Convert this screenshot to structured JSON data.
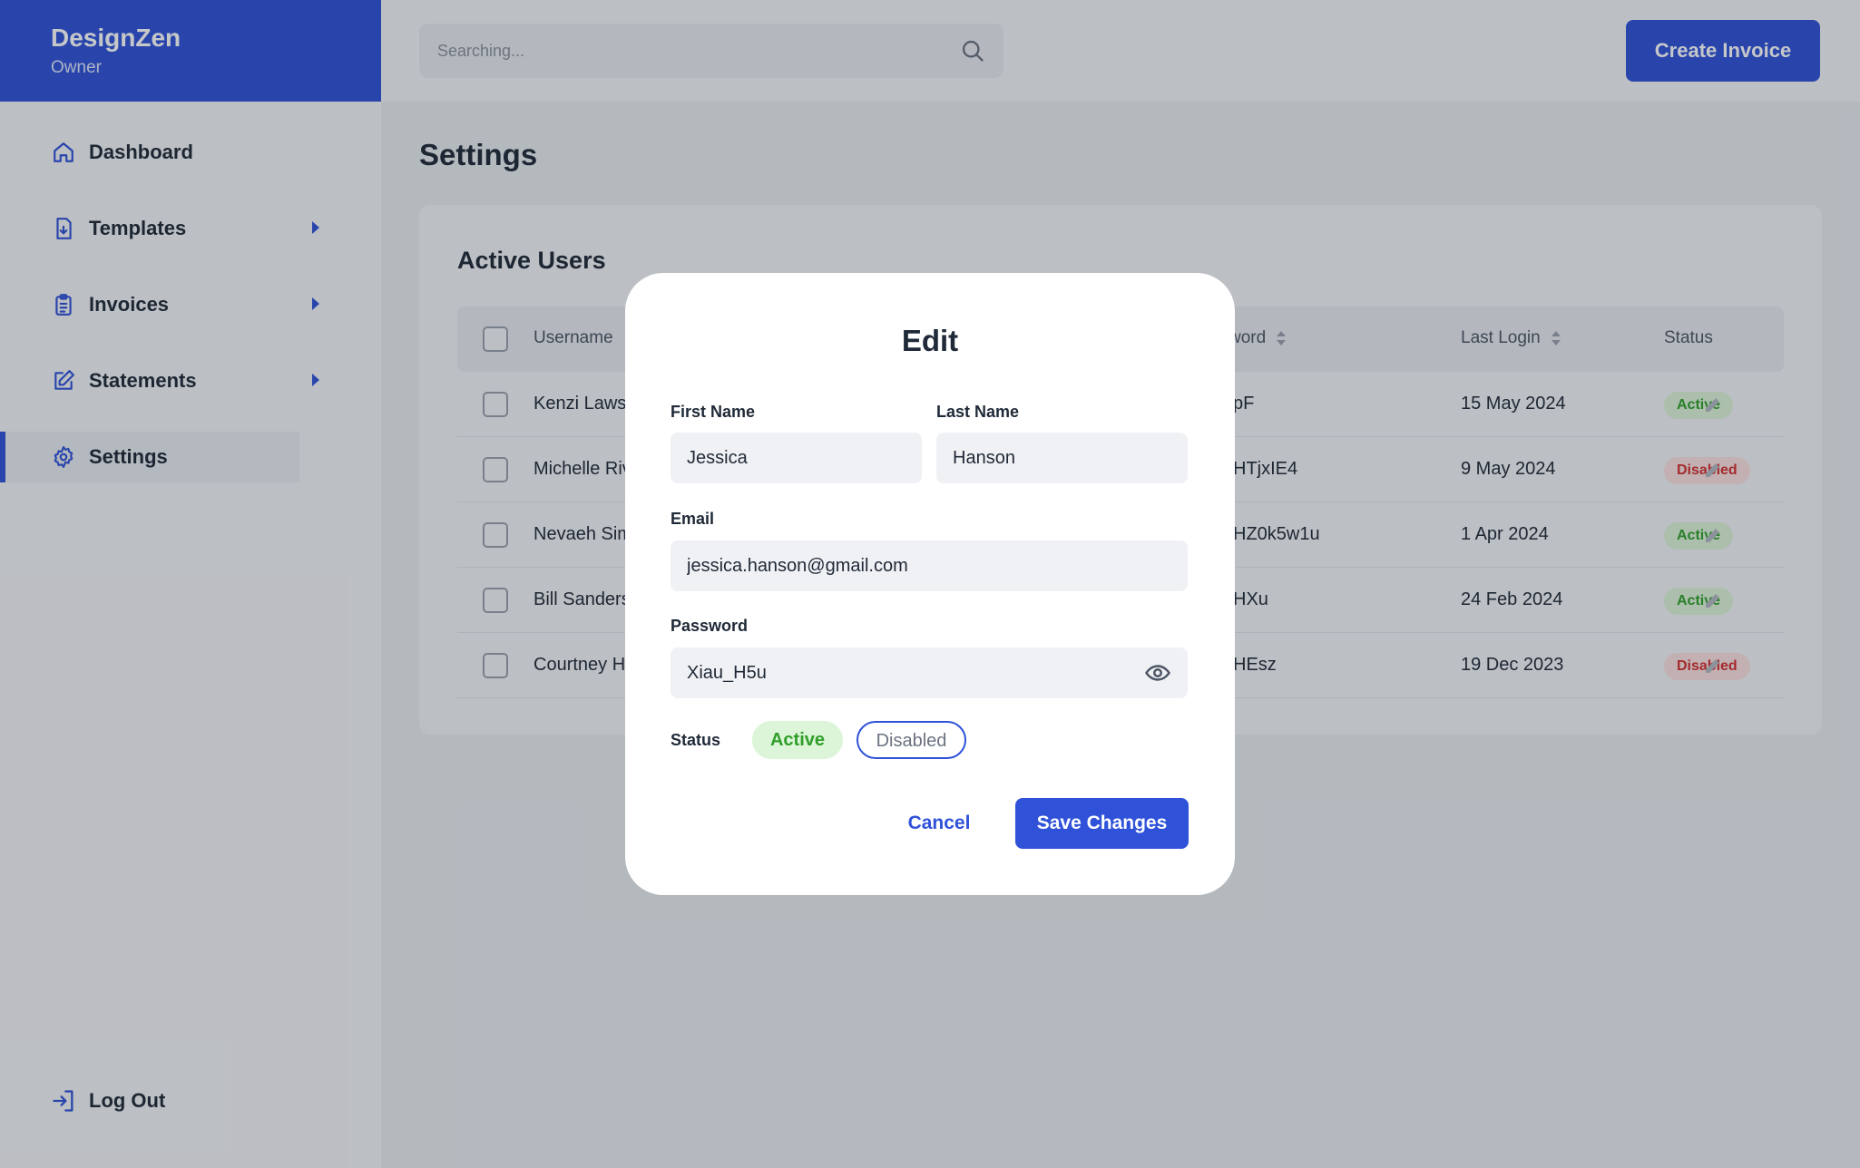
{
  "brand": {
    "name": "DesignZen",
    "role": "Owner"
  },
  "nav": {
    "items": [
      {
        "label": "Dashboard",
        "icon": "home-icon",
        "submenu": false
      },
      {
        "label": "Templates",
        "icon": "file-download-icon",
        "submenu": true
      },
      {
        "label": "Invoices",
        "icon": "clipboard-icon",
        "submenu": true
      },
      {
        "label": "Statements",
        "icon": "edit-square-icon",
        "submenu": true
      },
      {
        "label": "Settings",
        "icon": "gear-icon",
        "submenu": false,
        "active": true
      }
    ],
    "logout": "Log Out"
  },
  "topbar": {
    "search_placeholder": "Searching...",
    "create_label": "Create Invoice"
  },
  "page": {
    "title": "Settings"
  },
  "users_card": {
    "title": "Active Users",
    "columns": {
      "username": "Username",
      "password": "word",
      "last_login": "Last Login",
      "status": "Status"
    },
    "rows": [
      {
        "username": "Kenzi Laws",
        "password": "pF",
        "last_login": "15 May 2024",
        "status": "Active"
      },
      {
        "username": "Michelle Riv",
        "password": "HTjxIE4",
        "last_login": "9 May 2024",
        "status": "Disabled"
      },
      {
        "username": "Nevaeh Sim",
        "password": "HZ0k5w1u",
        "last_login": "1 Apr 2024",
        "status": "Active"
      },
      {
        "username": "Bill Sanders",
        "password": "HXu",
        "last_login": "24 Feb 2024",
        "status": "Active"
      },
      {
        "username": "Courtney H",
        "password": "HEsz",
        "last_login": "19 Dec 2023",
        "status": "Disabled"
      }
    ]
  },
  "modal": {
    "title": "Edit",
    "first_name_label": "First Name",
    "first_name": "Jessica",
    "last_name_label": "Last Name",
    "last_name": "Hanson",
    "email_label": "Email",
    "email": "jessica.hanson@gmail.com",
    "password_label": "Password",
    "password": "Xiau_H5u",
    "status_label": "Status",
    "status_active": "Active",
    "status_disabled": "Disabled",
    "cancel_label": "Cancel",
    "save_label": "Save Changes"
  },
  "colors": {
    "primary": "#2f52d9",
    "active_text": "#2f9e29",
    "active_bg": "#dcf5d8",
    "disabled_text": "#d32f2f",
    "disabled_bg": "#fbe0e0"
  }
}
